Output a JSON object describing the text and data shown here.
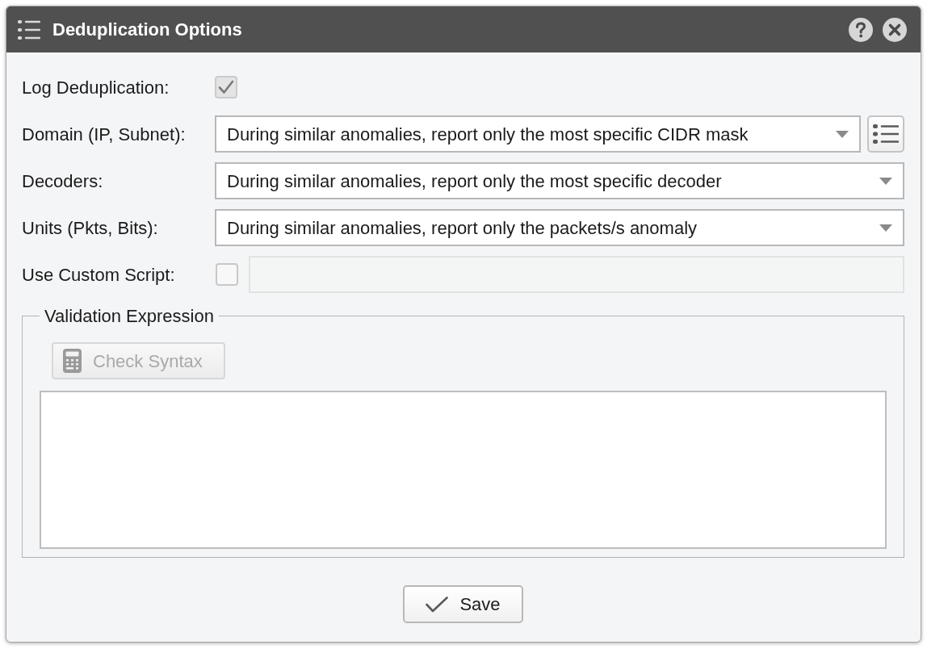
{
  "window": {
    "title": "Deduplication Options"
  },
  "fields": [
    {
      "kind": "checkbox",
      "label": "Log Deduplication:",
      "checked": true,
      "disabled": true
    },
    {
      "kind": "select",
      "label": "Domain (IP, Subnet):",
      "value": "During similar anomalies, report only the most specific CIDR mask",
      "list_button": true
    },
    {
      "kind": "select",
      "label": "Decoders:",
      "value": "During similar anomalies, report only the most specific decoder",
      "list_button": false
    },
    {
      "kind": "select",
      "label": "Units (Pkts, Bits):",
      "value": "During similar anomalies, report only the packets/s anomaly",
      "list_button": false
    },
    {
      "kind": "checkbox_input",
      "label": "Use Custom Script:",
      "checked": false,
      "disabled": false,
      "input": {
        "disabled": true
      }
    }
  ],
  "validation": {
    "legend": "Validation Expression",
    "check_button": {
      "label": "Check Syntax",
      "disabled": true
    }
  },
  "save_button": {
    "label": "Save"
  }
}
